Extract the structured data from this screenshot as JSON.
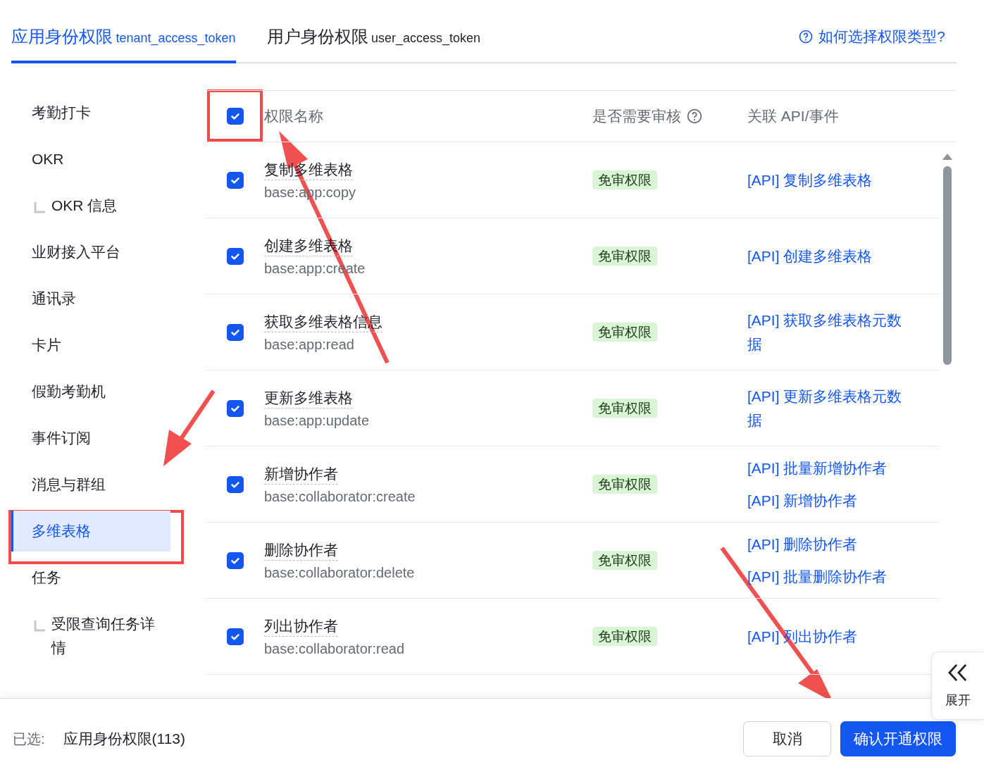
{
  "tabs": [
    {
      "label": "应用身份权限",
      "sub": "tenant_access_token",
      "selected": true
    },
    {
      "label": "用户身份权限",
      "sub": "user_access_token",
      "selected": false
    }
  ],
  "help_link": "如何选择权限类型?",
  "sidebar": {
    "items": [
      {
        "label": "考勤打卡",
        "selected": false
      },
      {
        "label": "OKR",
        "selected": false,
        "children": [
          {
            "label": "OKR 信息",
            "selected": false
          }
        ]
      },
      {
        "label": "业财接入平台",
        "selected": false
      },
      {
        "label": "通讯录",
        "selected": false
      },
      {
        "label": "卡片",
        "selected": false
      },
      {
        "label": "假勤考勤机",
        "selected": false
      },
      {
        "label": "事件订阅",
        "selected": false
      },
      {
        "label": "消息与群组",
        "selected": false
      },
      {
        "label": "多维表格",
        "selected": true
      },
      {
        "label": "任务",
        "selected": false,
        "children": [
          {
            "label": "受限查询任务详情",
            "selected": false
          }
        ]
      }
    ]
  },
  "table": {
    "select_all": {
      "checked": true
    },
    "columns": [
      "权限名称",
      "是否需要审核",
      "关联 API/事件"
    ],
    "rows": [
      {
        "checked": true,
        "name": "复制多维表格",
        "scope": "base:app:copy",
        "review": "免审权限",
        "apis": [
          "[API] 复制多维表格"
        ]
      },
      {
        "checked": true,
        "name": "创建多维表格",
        "scope": "base:app:create",
        "review": "免审权限",
        "apis": [
          "[API] 创建多维表格"
        ]
      },
      {
        "checked": true,
        "name": "获取多维表格信息",
        "scope": "base:app:read",
        "review": "免审权限",
        "apis": [
          "[API] 获取多维表格元数据"
        ]
      },
      {
        "checked": true,
        "name": "更新多维表格",
        "scope": "base:app:update",
        "review": "免审权限",
        "apis": [
          "[API] 更新多维表格元数据"
        ]
      },
      {
        "checked": true,
        "name": "新增协作者",
        "scope": "base:collaborator:create",
        "review": "免审权限",
        "apis": [
          "[API] 批量新增协作者",
          "[API] 新增协作者"
        ]
      },
      {
        "checked": true,
        "name": "删除协作者",
        "scope": "base:collaborator:delete",
        "review": "免审权限",
        "apis": [
          "[API] 删除协作者",
          "[API] 批量删除协作者"
        ]
      },
      {
        "checked": true,
        "name": "列出协作者",
        "scope": "base:collaborator:read",
        "review": "免审权限",
        "apis": [
          "[API] 列出协作者"
        ]
      }
    ]
  },
  "expand_panel": {
    "label": "展开"
  },
  "footer": {
    "selected_label": "已选:",
    "selected_value": "应用身份权限(113)",
    "buttons": [
      {
        "label": "取消",
        "kind": "secondary"
      },
      {
        "label": "确认开通权限",
        "kind": "primary"
      }
    ]
  }
}
